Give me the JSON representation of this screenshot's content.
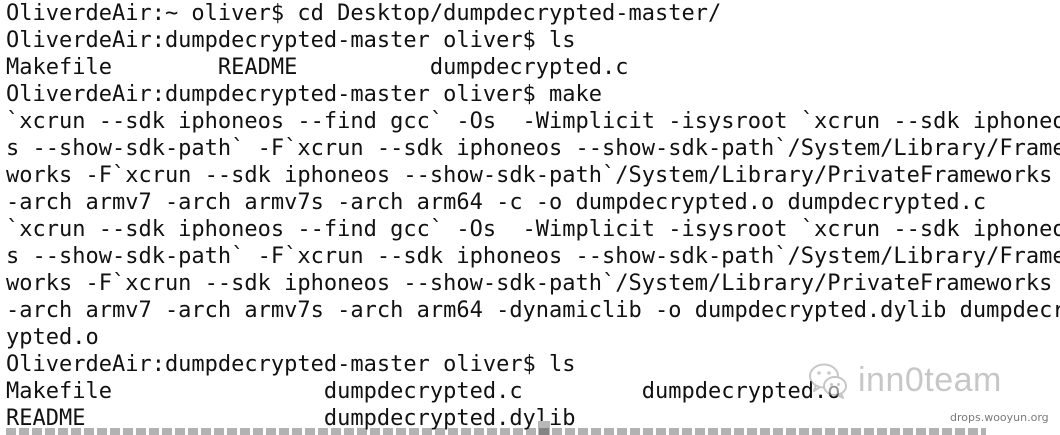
{
  "terminal": {
    "lines": [
      "OliverdeAir:~ oliver$ cd Desktop/dumpdecrypted-master/",
      "OliverdeAir:dumpdecrypted-master oliver$ ls",
      "Makefile        README          dumpdecrypted.c",
      "OliverdeAir:dumpdecrypted-master oliver$ make",
      "`xcrun --sdk iphoneos --find gcc` -Os  -Wimplicit -isysroot `xcrun --sdk iphoneo",
      "s --show-sdk-path` -F`xcrun --sdk iphoneos --show-sdk-path`/System/Library/Frame",
      "works -F`xcrun --sdk iphoneos --show-sdk-path`/System/Library/PrivateFrameworks",
      "-arch armv7 -arch armv7s -arch arm64 -c -o dumpdecrypted.o dumpdecrypted.c",
      "`xcrun --sdk iphoneos --find gcc` -Os  -Wimplicit -isysroot `xcrun --sdk iphoneo",
      "s --show-sdk-path` -F`xcrun --sdk iphoneos --show-sdk-path`/System/Library/Frame",
      "works -F`xcrun --sdk iphoneos --show-sdk-path`/System/Library/PrivateFrameworks",
      "-arch armv7 -arch armv7s -arch arm64 -dynamiclib -o dumpdecrypted.dylib dumpdecr",
      "ypted.o",
      "OliverdeAir:dumpdecrypted-master oliver$ ls",
      "Makefile                dumpdecrypted.c         dumpdecrypted.o",
      "README                  dumpdecrypted.dylib"
    ]
  },
  "watermark": {
    "text": "inn0team",
    "icon": "wechat-icon"
  },
  "source": {
    "text": "drops.wooyun.org"
  }
}
